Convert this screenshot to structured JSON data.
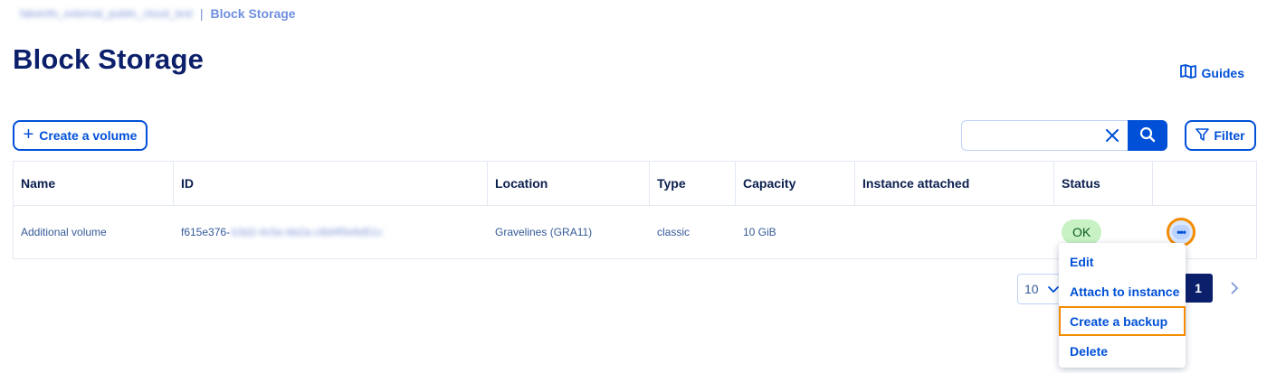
{
  "breadcrumb": {
    "project": "fakeinfo_external_public_cloud_test",
    "separator": "|",
    "current": "Block Storage"
  },
  "page_title": "Block Storage",
  "guides_label": "Guides",
  "create_button_label": "Create a volume",
  "search": {
    "value": ""
  },
  "filter_button_label": "Filter",
  "table": {
    "columns": [
      "Name",
      "ID",
      "Location",
      "Type",
      "Capacity",
      "Instance attached",
      "Status",
      ""
    ],
    "rows": [
      {
        "name": "Additional volume",
        "id_prefix": "f615e376-",
        "id_rest": "b3d2-4c5e-bb2a-c8d4f0e6d51c",
        "location": "Gravelines (GRA11)",
        "type": "classic",
        "capacity": "10 GiB",
        "instance_attached": "",
        "status": "OK"
      }
    ]
  },
  "pagination": {
    "page_size": "10",
    "current_page": "1"
  },
  "action_menu": {
    "items": [
      "Edit",
      "Attach to instance",
      "Create a backup",
      "Delete"
    ],
    "highlighted": "Create a backup"
  },
  "colors": {
    "primary": "#0050d7",
    "title": "#0b1f6b",
    "highlight": "#f28c00",
    "status_ok_bg": "#c8f2c3"
  },
  "icons": {
    "guides": "book-map-icon",
    "create": "plus-icon",
    "clear": "close-icon",
    "search": "search-icon",
    "filter": "filter-icon",
    "more": "more-dots-icon",
    "dropdown": "chevron-down-icon",
    "next": "chevron-right-icon"
  }
}
